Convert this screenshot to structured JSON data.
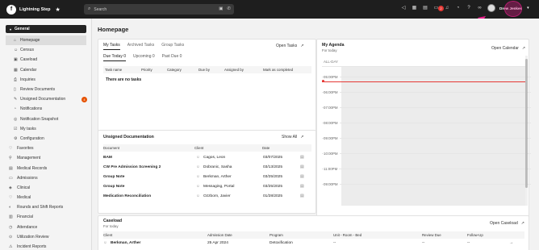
{
  "app": {
    "name": "Lightning Step",
    "logo_letter": "f"
  },
  "search": {
    "placeholder": "Search"
  },
  "badges": {
    "notifications": "2"
  },
  "user": {
    "name": "Drew Jenkes"
  },
  "sidebar": {
    "section": "General",
    "items": [
      {
        "label": "Homepage",
        "icon": "home-icon",
        "active": true
      },
      {
        "label": "Census",
        "icon": "people-icon"
      },
      {
        "label": "Caseload",
        "icon": "caseload-icon"
      },
      {
        "label": "Calendar",
        "icon": "calendar-icon"
      },
      {
        "label": "Inquiries",
        "icon": "inquiries-icon"
      },
      {
        "label": "Review Documents",
        "icon": "document-icon"
      },
      {
        "label": "Unsigned Documentation",
        "icon": "pen-icon",
        "badge": "4"
      },
      {
        "label": "Notifications",
        "icon": "bell-icon"
      },
      {
        "label": "Notification Snapshot",
        "icon": "snapshot-icon"
      },
      {
        "label": "My tasks",
        "icon": "tasks-icon"
      },
      {
        "label": "Configuration",
        "icon": "gear-icon"
      }
    ],
    "groups": [
      {
        "label": "Favorites",
        "icon": "heart-icon"
      },
      {
        "label": "Management",
        "icon": "management-icon"
      },
      {
        "label": "Medical Records",
        "icon": "records-icon"
      },
      {
        "label": "Admissions",
        "icon": "admissions-icon"
      },
      {
        "label": "Clinical",
        "icon": "clinical-icon"
      },
      {
        "label": "Medical",
        "icon": "medical-icon"
      },
      {
        "label": "Rounds and Shift Reports",
        "icon": "rounds-icon"
      },
      {
        "label": "Financial",
        "icon": "financial-icon"
      },
      {
        "label": "Attendance",
        "icon": "attendance-icon"
      },
      {
        "label": "Utilization Review",
        "icon": "review-icon"
      },
      {
        "label": "Incident Reports",
        "icon": "incident-icon"
      }
    ]
  },
  "page": {
    "title": "Homepage"
  },
  "tasks": {
    "tabs": [
      "My Tasks",
      "Archived Tasks",
      "Group Tasks"
    ],
    "open_label": "Open Tasks",
    "subtabs": [
      "Due Today 0",
      "Upcoming 0",
      "Past Due 0"
    ],
    "columns": [
      "Task name",
      "Priority",
      "Category",
      "Due by",
      "Assigned by",
      "Mark as completed"
    ],
    "empty": "There are no tasks"
  },
  "agenda": {
    "title": "My Agenda",
    "subtitle": "For today",
    "open_label": "Open Calendar",
    "all_day": "ALL-DAY",
    "hours": [
      "05:00PM",
      "06:00PM",
      "07:00PM",
      "08:00PM",
      "09:00PM",
      "10:00PM",
      "11:00PM",
      "09:00PM"
    ]
  },
  "unsigned": {
    "title": "Unsigned Documentation",
    "show_all": "Show All",
    "columns": [
      "Document",
      "Client",
      "Date"
    ],
    "rows": [
      {
        "document": "BAM",
        "client": "Cagos, Leon",
        "date": "03/07/2025"
      },
      {
        "document": "CW Pre Admission Screening 2",
        "client": "Dobranic, Sasha",
        "date": "03/13/2025"
      },
      {
        "document": "Group Note",
        "client": "Berkman, Arther",
        "date": "03/25/2025"
      },
      {
        "document": "Group Note",
        "client": "Messaging, Portal",
        "date": "03/25/2025"
      },
      {
        "document": "Medication Reconciliation",
        "client": "Ozzborn, Javier",
        "date": "01/28/2025"
      }
    ]
  },
  "caseload": {
    "title": "Caseload",
    "subtitle": "For today",
    "open_label": "Open Caseload",
    "columns": [
      "Client",
      "Admission Date",
      "Program",
      "Unit - Room - Bed",
      "Review Due",
      "Follow-Up"
    ],
    "rows": [
      {
        "client": "Berkman, Arther",
        "admission": "25 Apr 2024",
        "program": "Detoxification",
        "unit": "--",
        "review": "--",
        "followup": "--"
      }
    ]
  },
  "colors": {
    "accent": "#e91e8c",
    "dark": "#1e1e1e",
    "badge": "#e53935"
  }
}
